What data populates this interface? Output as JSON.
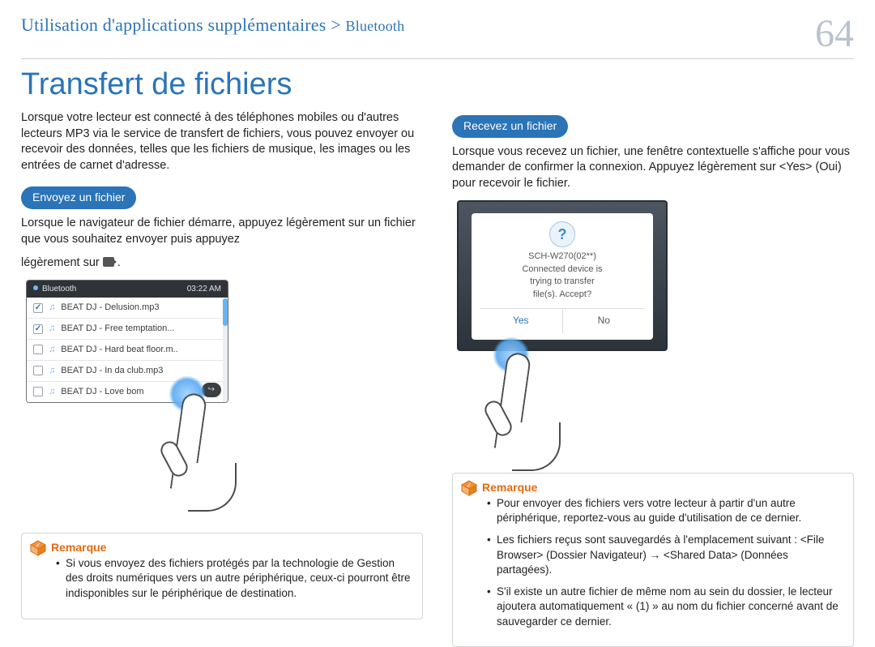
{
  "header": {
    "breadcrumb_main": "Utilisation d'applications supplémentaires",
    "breadcrumb_sep": " > ",
    "breadcrumb_sub": "Bluetooth",
    "page_number": "64"
  },
  "title": "Transfert de fichiers",
  "left": {
    "intro": "Lorsque votre lecteur est connecté à des téléphones mobiles ou d'autres lecteurs MP3 via le service de transfert de fichiers, vous pouvez envoyer ou recevoir des données, telles que les fichiers de musique, les images ou les entrées de carnet d'adresse.",
    "send_pill": "Envoyez un fichier",
    "send_text": "Lorsque le navigateur de fichier démarre, appuyez légèrement sur un fichier que vous souhaitez envoyer puis appuyez",
    "send_text2_prefix": "légèrement sur ",
    "send_text2_suffix": ".",
    "device": {
      "bar_label": "Bluetooth",
      "bar_time": "03:22 AM",
      "files": [
        {
          "checked": true,
          "name": "BEAT DJ - Delusion.mp3"
        },
        {
          "checked": true,
          "name": "BEAT DJ - Free temptation..."
        },
        {
          "checked": false,
          "name": "BEAT DJ - Hard beat floor.m.."
        },
        {
          "checked": false,
          "name": "BEAT DJ - In da club.mp3"
        },
        {
          "checked": false,
          "name": "BEAT DJ - Love bom"
        }
      ]
    },
    "note_label": "Remarque",
    "note_text": "Si vous envoyez des fichiers protégés par la technologie de Gestion des droits numériques vers un autre périphérique, ceux-ci pourront être indisponibles sur le périphérique de destination."
  },
  "right": {
    "recv_pill": "Recevez un fichier",
    "recv_text": "Lorsque vous recevez un fichier, une fenêtre contextuelle s'affiche pour vous demander de confirmer la connexion. Appuyez légèrement sur <Yes> (Oui) pour recevoir le fichier.",
    "recv_device": {
      "device_line": "SCH-W270(02**)",
      "msg_l1": "Connected device is",
      "msg_l2": "trying to transfer",
      "msg_l3": "file(s). Accept?",
      "btn_yes": "Yes",
      "btn_no": "No"
    },
    "note_label": "Remarque",
    "notes": [
      "Pour envoyer des fichiers vers votre lecteur à partir d'un autre périphérique, reportez-vous au guide d'utilisation de ce dernier.",
      "Les fichiers reçus sont sauvegardés à l'emplacement suivant : <File Browser> (Dossier Navigateur) → <Shared Data> (Données partagées).",
      "S'il existe un autre fichier de même nom au sein du dossier, le lecteur ajoutera automatiquement « (1) » au nom du fichier concerné avant de sauvegarder ce dernier."
    ]
  }
}
